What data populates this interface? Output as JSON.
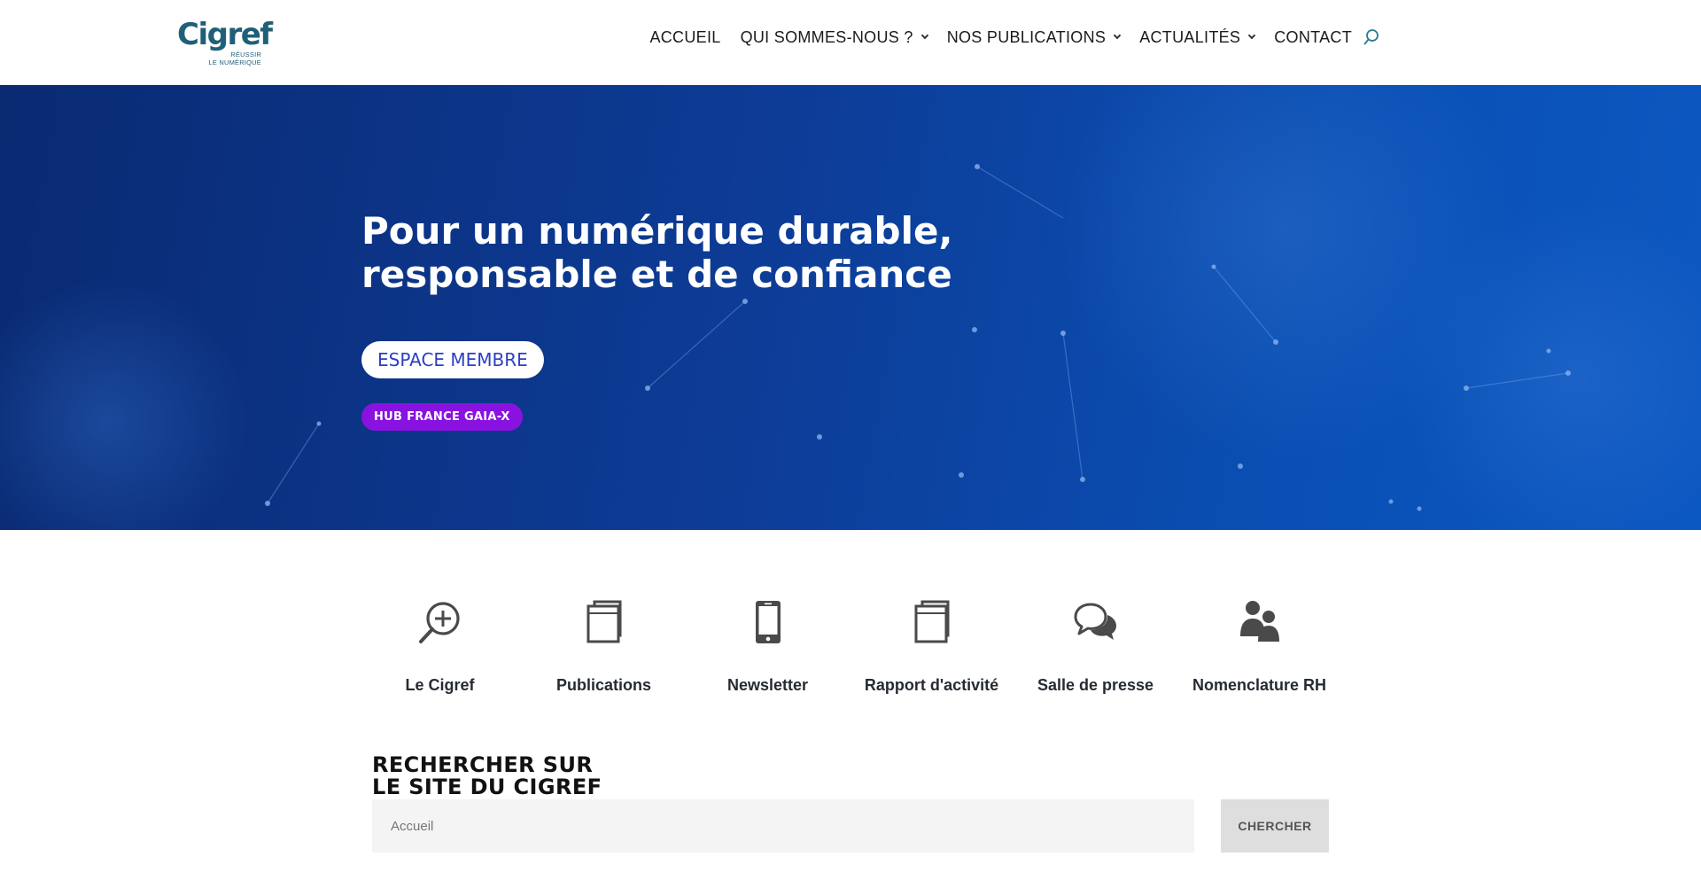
{
  "header": {
    "logo": {
      "word": "Cigref",
      "tagline_1": "RÉUSSIR",
      "tagline_2": "LE NUMÉRIQUE"
    },
    "nav": [
      {
        "label": "ACCUEIL",
        "has_dropdown": false
      },
      {
        "label": "QUI SOMMES-NOUS ?",
        "has_dropdown": true
      },
      {
        "label": "NOS PUBLICATIONS",
        "has_dropdown": true
      },
      {
        "label": "ACTUALITÉS",
        "has_dropdown": true
      },
      {
        "label": "CONTACT",
        "has_dropdown": false
      }
    ],
    "search_icon": "search-icon"
  },
  "hero": {
    "title_line_1": "Pour un numérique durable,",
    "title_line_2": "responsable et de confiance",
    "member_button": "ESPACE MEMBRE",
    "gaia_button": "HUB FRANCE GAIA-X",
    "colors": {
      "background_start": "#0a2a72",
      "background_end": "#0c58c2",
      "member_text": "#2c3fc4",
      "gaia_bg": "#8a12e0"
    }
  },
  "quick_links": [
    {
      "label": "Le Cigref",
      "icon": "zoom-in-icon"
    },
    {
      "label": "Publications",
      "icon": "book-icon"
    },
    {
      "label": "Newsletter",
      "icon": "mobile-phone-icon"
    },
    {
      "label": "Rapport d'activité",
      "icon": "book-icon"
    },
    {
      "label": "Salle de presse",
      "icon": "chat-bubbles-icon"
    },
    {
      "label": "Nomenclature RH",
      "icon": "people-icon"
    }
  ],
  "site_search": {
    "title_line_1": "RECHERCHER SUR",
    "title_line_2": "LE SITE DU CIGREF",
    "placeholder": "Accueil",
    "button_label": "CHERCHER"
  }
}
